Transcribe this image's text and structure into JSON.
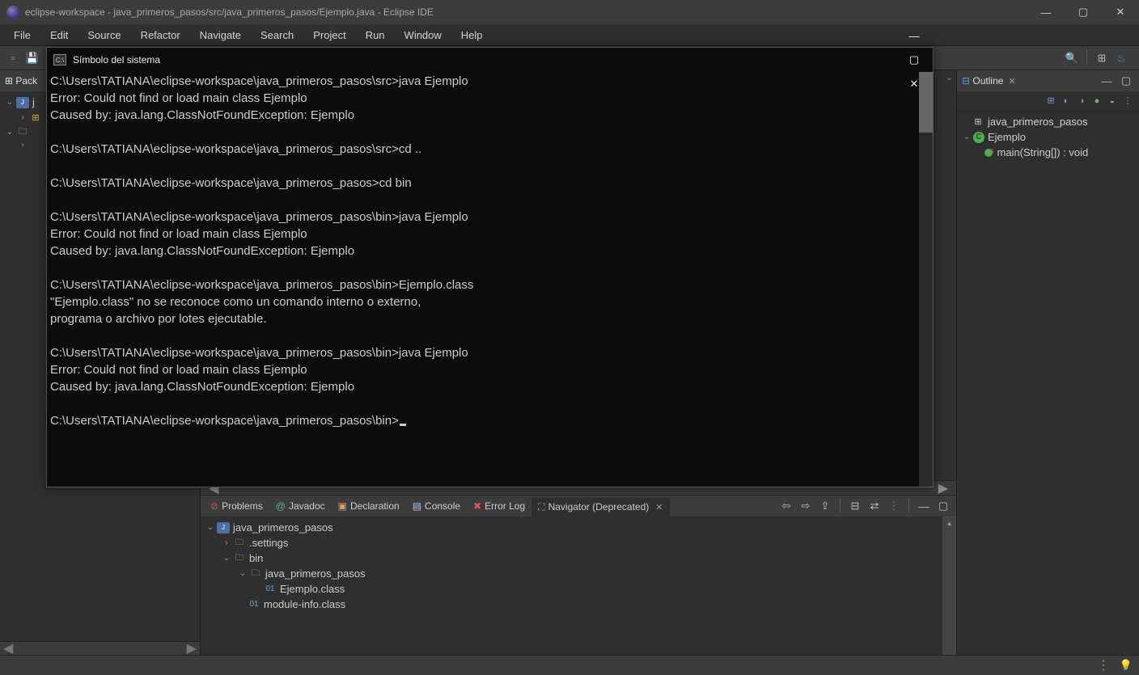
{
  "window_title": "eclipse-workspace - java_primeros_pasos/src/java_primeros_pasos/Ejemplo.java - Eclipse IDE",
  "menu": [
    "File",
    "Edit",
    "Source",
    "Refactor",
    "Navigate",
    "Search",
    "Project",
    "Run",
    "Window",
    "Help"
  ],
  "left_panel_title": "Pack",
  "left_tree": {
    "root": "j",
    "children": [
      ""
    ]
  },
  "right_panel_title": "Outline",
  "outline": {
    "package": "java_primeros_pasos",
    "class": "Ejemplo",
    "method": "main(String[]) : void"
  },
  "cmd": {
    "title": "Símbolo del sistema",
    "lines": [
      "C:\\Users\\TATIANA\\eclipse-workspace\\java_primeros_pasos\\src>java Ejemplo",
      "Error: Could not find or load main class Ejemplo",
      "Caused by: java.lang.ClassNotFoundException: Ejemplo",
      "",
      "C:\\Users\\TATIANA\\eclipse-workspace\\java_primeros_pasos\\src>cd ..",
      "",
      "C:\\Users\\TATIANA\\eclipse-workspace\\java_primeros_pasos>cd bin",
      "",
      "C:\\Users\\TATIANA\\eclipse-workspace\\java_primeros_pasos\\bin>java Ejemplo",
      "Error: Could not find or load main class Ejemplo",
      "Caused by: java.lang.ClassNotFoundException: Ejemplo",
      "",
      "C:\\Users\\TATIANA\\eclipse-workspace\\java_primeros_pasos\\bin>Ejemplo.class",
      "\"Ejemplo.class\" no se reconoce como un comando interno o externo,",
      "programa o archivo por lotes ejecutable.",
      "",
      "C:\\Users\\TATIANA\\eclipse-workspace\\java_primeros_pasos\\bin>java Ejemplo",
      "Error: Could not find or load main class Ejemplo",
      "Caused by: java.lang.ClassNotFoundException: Ejemplo",
      "",
      "C:\\Users\\TATIANA\\eclipse-workspace\\java_primeros_pasos\\bin>"
    ]
  },
  "bottom_tabs": {
    "problems": "Problems",
    "javadoc": "Javadoc",
    "declaration": "Declaration",
    "console": "Console",
    "errorlog": "Error Log",
    "navigator": "Navigator (Deprecated)"
  },
  "navigator_tree": {
    "root": "java_primeros_pasos",
    "settings": ".settings",
    "bin": "bin",
    "bin_pkg": "java_primeros_pasos",
    "ejemplo_class": "Ejemplo.class",
    "module_info": "module-info.class"
  }
}
